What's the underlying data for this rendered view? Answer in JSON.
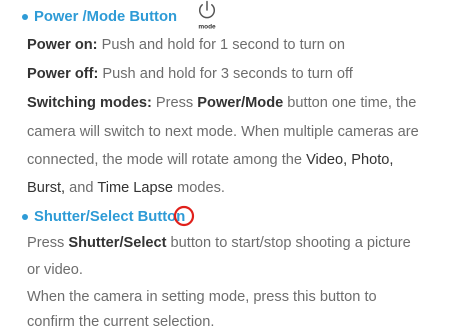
{
  "colors": {
    "accent": "#2e9bd6",
    "bullet": "#2e9bd6",
    "shutter_icon": "#e0201b",
    "text": "#6d6d6d",
    "emphasis": "#333333"
  },
  "power": {
    "heading": "Power /Mode Button",
    "icon_name": "power-icon",
    "icon_label": "mode",
    "on_label": "Power on:",
    "on_text": " Push and hold for 1 second to turn on",
    "off_label": "Power off:",
    "off_text": " Push and hold for 3 seconds to turn off",
    "switch_label": "Switching modes:",
    "switch_text_1": " Press ",
    "switch_btn": "Power/Mode",
    "switch_text_2": " button one time, the",
    "switch_line2": "camera will switch to next mode. When multiple cameras are",
    "switch_line3_a": "connected, the mode will rotate among the  ",
    "mode_video": "Video, Photo,",
    "mode_burst": "Burst,",
    "switch_line4_mid": " and ",
    "mode_timelapse": "Time Lapse",
    "switch_line4_end": " modes."
  },
  "shutter": {
    "heading": "Shutter/Select Button",
    "icon_name": "shutter-circle-icon",
    "line1_a": "Press ",
    "line1_btn": "Shutter/Select",
    "line1_b": " button to start/stop shooting a picture",
    "line2": "or video.",
    "line3": "When the camera in setting mode, press this button to",
    "line4": "confirm the current selection."
  }
}
